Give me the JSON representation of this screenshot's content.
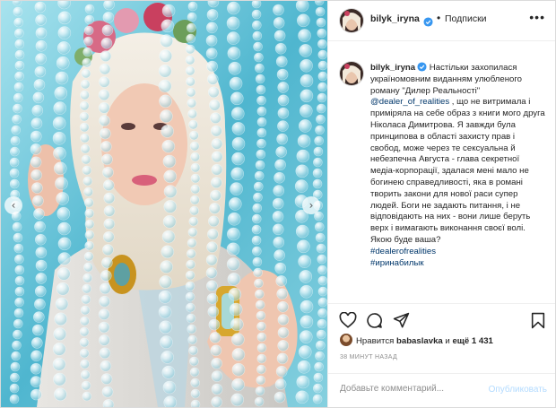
{
  "post": {
    "username": "bilyk_iryna",
    "follow_label": "Подписки",
    "more_icon": "more-dots-icon",
    "caption": {
      "username": "bilyk_iryna",
      "text_1": " Настільки захопилася україномовним виданням улюбленого роману \"Дилер Реальності\" ",
      "mention": "@dealer_of_realities",
      "text_2": " , що не витримала і приміряла на себе образ з книги мого друга Ніколаса Димитрова. Я завжди була принципова в області захисту прав і свобод, може через те сексуальна й небезпечна Августа - глава секретної медіа-корпорації, здалася мені мало не богинею справедливості, яка в романі творить закони для нової раси супер людей. Боги не задають питання, і не відповідають на них - вони лише беруть верх і вимагають виконання своєї волі. Якою буде ваша?",
      "hashtag_1": "#dealerofrealities",
      "hashtag_2": "#иринабилык"
    },
    "likes": {
      "prefix": "Нравится ",
      "user": "babaslavka",
      "middle": " и ",
      "others": "ещё 1 431"
    },
    "time_ago": "38 МИНУТ НАЗАД",
    "comment": {
      "placeholder": "Добавьте комментарий...",
      "publish_label": "Опубликовать"
    }
  },
  "icons": [
    "heart-icon",
    "comment-icon",
    "share-icon",
    "bookmark-icon",
    "verified-badge-icon",
    "chevron-left-icon",
    "chevron-right-icon"
  ],
  "colors": {
    "link": "#00376b",
    "verified": "#3897f0",
    "publish_disabled": "#b3dbff",
    "secondary_text": "#8e8e8e",
    "border": "#efefef",
    "photo_bg": "#5cbfd6"
  },
  "carousel": {
    "prev": "‹",
    "next": "›"
  }
}
